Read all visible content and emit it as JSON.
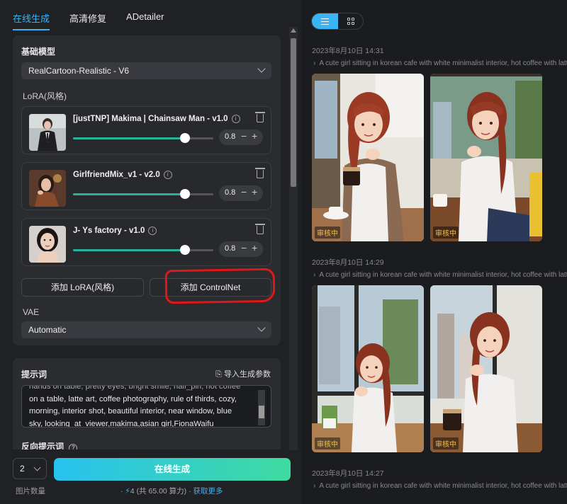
{
  "tabs": [
    "在线生成",
    "高清修复",
    "ADetailer"
  ],
  "base_model": {
    "title": "基础模型",
    "value": "RealCartoon-Realistic - V6"
  },
  "lora_section": {
    "title": "LoRA(风格)"
  },
  "loras": [
    {
      "name": "[justTNP] Makima | Chainsaw Man - v1.0",
      "weight": "0.8",
      "slider": 0.8
    },
    {
      "name": "GirlfriendMix_v1 - v2.0",
      "weight": "0.8",
      "slider": 0.8
    },
    {
      "name": "J- Ys factory - v1.0",
      "weight": "0.8",
      "slider": 0.8
    }
  ],
  "buttons": {
    "add_lora": "添加 LoRA(风格)",
    "add_controlnet": "添加 ControlNet"
  },
  "vae": {
    "title": "VAE",
    "value": "Automatic"
  },
  "prompt": {
    "title": "提示词",
    "import_label": "导入生成参数",
    "text_lines": [
      "hands on table, pretty eyes, bright smile, half_pin, hot coffee",
      "on a table, latte art, coffee photography, rule of thirds, cozy,",
      "morning, interior shot, beautiful interior, near window, blue",
      "sky, looking_at_viewer,makima,asian girl,FionaWaifu"
    ]
  },
  "negative_prompt": {
    "title": "反向提示词"
  },
  "bottom": {
    "count": "2",
    "count_label": "图片数量",
    "generate_label": "在线生成",
    "cost_amount": "4",
    "cost_text": "(共 65.00 算力)",
    "get_more": "获取更多"
  },
  "history": [
    {
      "date": "2023年8月10日 14:31",
      "desc": "A cute girl sitting in korean cafe with white minimalist interior, hot coffee with latte",
      "status": [
        "审核中",
        "审核中"
      ]
    },
    {
      "date": "2023年8月10日 14:29",
      "desc": "A cute girl sitting in korean cafe with white minimalist interior, hot coffee with latte",
      "status": [
        "审核中",
        "审核中"
      ]
    },
    {
      "date": "2023年8月10日 14:27",
      "desc": "A cute girl sitting in korean cafe with white minimalist interior, hot coffee with latte",
      "status": []
    }
  ],
  "colors": {
    "accent": "#3ab4f2",
    "slider": "#2ab39b",
    "badge": "#f2c14e",
    "annotation": "#e01818"
  }
}
